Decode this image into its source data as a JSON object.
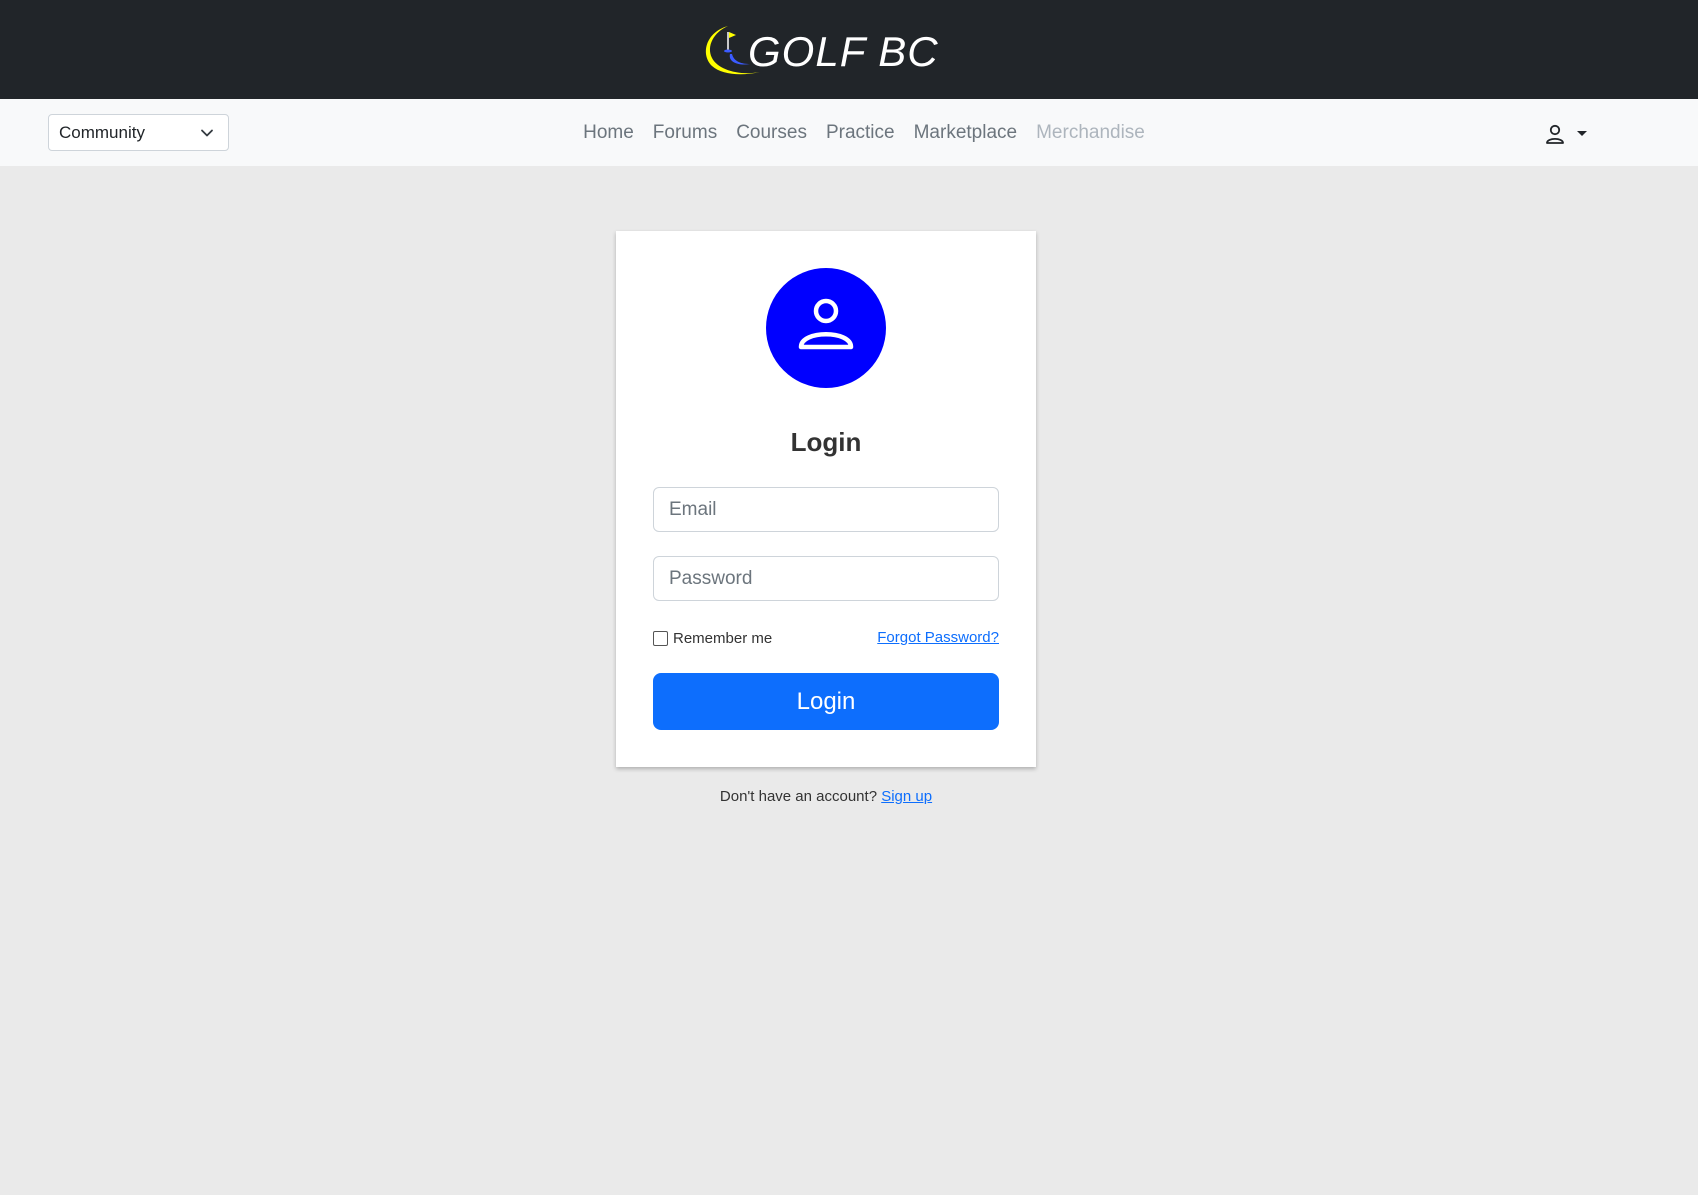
{
  "brand": {
    "logo_text": "GOLF BC",
    "logo_colors": [
      "#ffff00",
      "#3b5bff"
    ]
  },
  "navbar": {
    "community_select": {
      "value": "Community"
    },
    "links": [
      {
        "label": "Home",
        "disabled": false
      },
      {
        "label": "Forums",
        "disabled": false
      },
      {
        "label": "Courses",
        "disabled": false
      },
      {
        "label": "Practice",
        "disabled": false
      },
      {
        "label": "Marketplace",
        "disabled": false
      },
      {
        "label": "Merchandise",
        "disabled": true
      }
    ],
    "user_menu": {
      "icon": "user-icon"
    }
  },
  "login": {
    "avatar_icon": "user-icon",
    "avatar_color": "#0000ff",
    "title": "Login",
    "email_placeholder": "Email",
    "password_placeholder": "Password",
    "remember_label": "Remember me",
    "forgot_label": "Forgot Password?",
    "submit_label": "Login",
    "primary_color": "#0d6efd"
  },
  "signup": {
    "prompt": "Don't have an account?",
    "link_label": "Sign up"
  }
}
